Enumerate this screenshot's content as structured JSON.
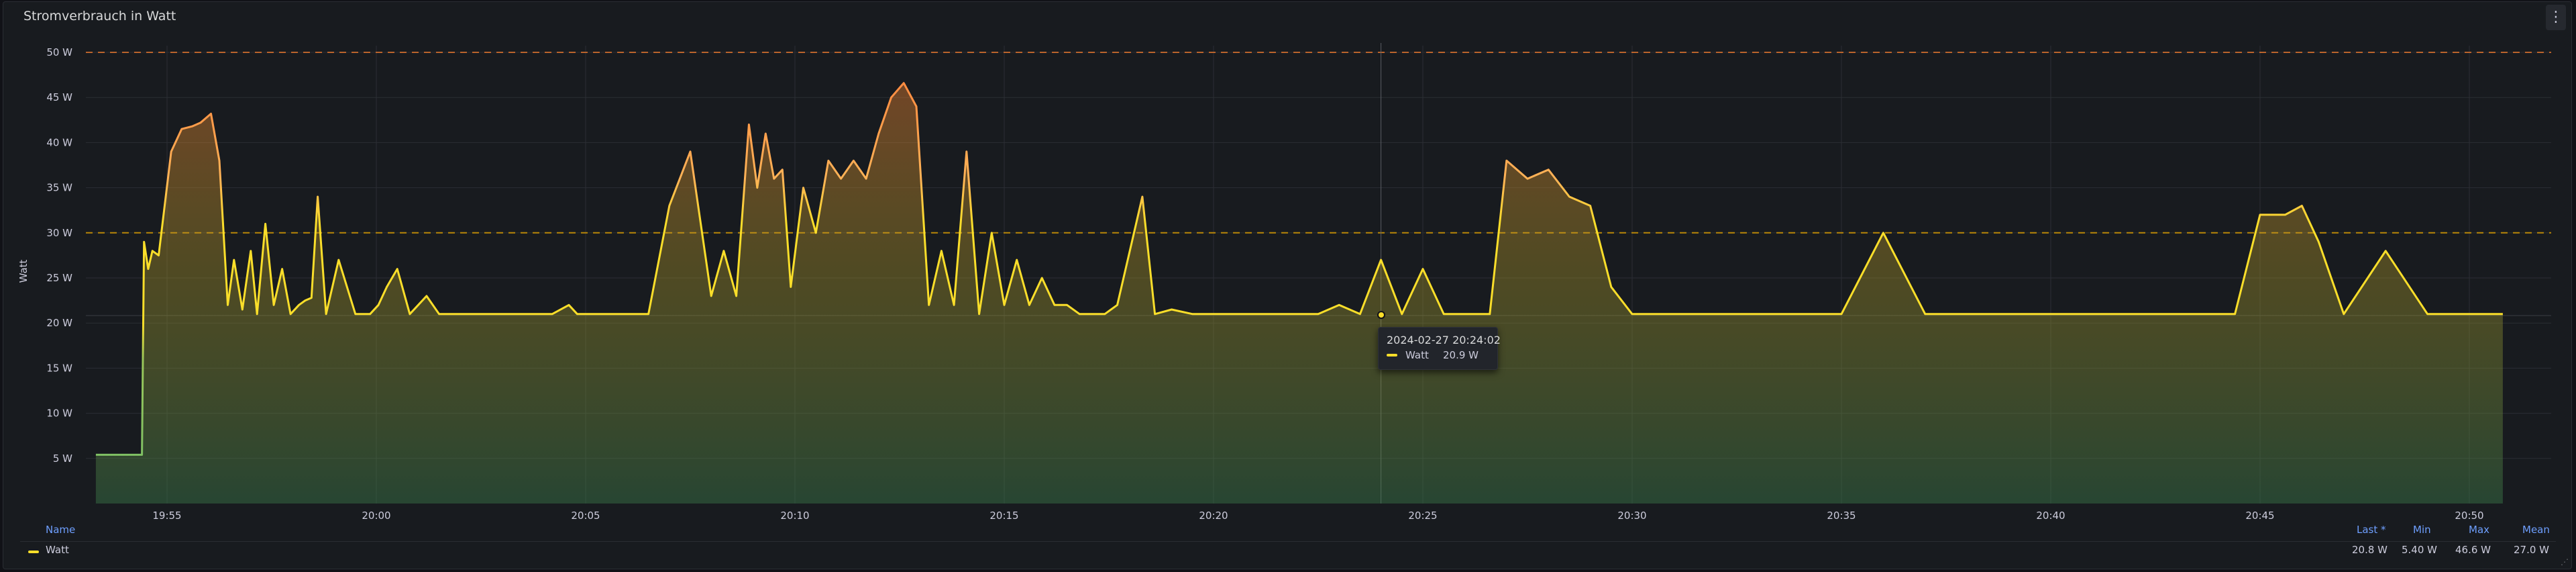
{
  "panel": {
    "title": "Stromverbrauch in Watt",
    "menu_icon": "⋮",
    "resize_icon": "⋰"
  },
  "colors": {
    "series": "#fade2a",
    "threshold_orange": "#ff9830",
    "threshold_red": "#e0752d",
    "grid": "#2b2e34",
    "axis_text": "#ccccdc"
  },
  "tooltip": {
    "time": "2024-02-27 20:24:02",
    "series": "Watt",
    "value": "20.9 W"
  },
  "legend": {
    "headers": {
      "name": "Name",
      "last": "Last *",
      "min": "Min",
      "max": "Max",
      "mean": "Mean"
    },
    "rows": [
      {
        "name": "Watt",
        "color": "#fade2a",
        "last": "20.8 W",
        "min": "5.40 W",
        "max": "46.6 W",
        "mean": "27.0 W"
      }
    ]
  },
  "chart_data": {
    "type": "area",
    "ylabel": "Watt",
    "ylim": [
      0,
      50
    ],
    "yticks": [
      "5 W",
      "10 W",
      "15 W",
      "20 W",
      "25 W",
      "30 W",
      "35 W",
      "40 W",
      "45 W",
      "50 W"
    ],
    "xticks": [
      "19:55",
      "20:00",
      "20:05",
      "20:10",
      "20:15",
      "20:20",
      "20:25",
      "20:30",
      "20:35",
      "20:40",
      "20:45",
      "20:50"
    ],
    "xlim_minutes_from_19_55": [
      -1.7,
      55.8
    ],
    "thresholds": [
      {
        "value": 30,
        "color": "#e0a000"
      },
      {
        "value": 50,
        "color": "#e0752d"
      }
    ],
    "hover_minute": 29.0,
    "series": [
      {
        "name": "Watt",
        "x_minutes_from_19_55": [
          -1.7,
          -0.6,
          -0.55,
          -0.45,
          -0.35,
          -0.2,
          0.1,
          0.35,
          0.6,
          0.8,
          1.05,
          1.25,
          1.45,
          1.6,
          1.8,
          2.0,
          2.15,
          2.35,
          2.55,
          2.75,
          2.95,
          3.15,
          3.3,
          3.45,
          3.6,
          3.8,
          4.1,
          4.5,
          4.85,
          5.05,
          5.25,
          5.5,
          5.8,
          6.2,
          6.5,
          6.8,
          7.2,
          7.6,
          8.0,
          8.4,
          8.8,
          9.2,
          9.6,
          9.8,
          10.0,
          10.5,
          11.0,
          11.5,
          12.0,
          12.5,
          13.0,
          13.3,
          13.6,
          13.9,
          14.1,
          14.3,
          14.5,
          14.7,
          14.9,
          15.2,
          15.5,
          15.8,
          16.1,
          16.4,
          16.7,
          17.0,
          17.3,
          17.6,
          17.9,
          18.2,
          18.5,
          18.8,
          19.1,
          19.4,
          19.7,
          20.0,
          20.3,
          20.6,
          20.9,
          21.2,
          21.5,
          21.8,
          22.1,
          22.4,
          22.7,
          23.0,
          23.3,
          23.6,
          24.0,
          24.5,
          25.0,
          25.5,
          26.0,
          26.5,
          27.0,
          27.5,
          28.0,
          28.5,
          29.0,
          29.5,
          30.0,
          30.5,
          31.0,
          31.2,
          31.4,
          31.6,
          32.0,
          32.5,
          33.0,
          33.5,
          34.0,
          34.5,
          35.0,
          35.4,
          35.6,
          36.0,
          37.0,
          38.0,
          39.0,
          39.3,
          39.6,
          40.0,
          41.0,
          42.0,
          43.0,
          44.0,
          45.0,
          46.0,
          47.0,
          48.0,
          49.0,
          49.4,
          50.0,
          50.6,
          51.0,
          51.4,
          52.0,
          53.0,
          54.0,
          55.0,
          55.8
        ],
        "values": [
          5.4,
          5.4,
          29,
          26,
          28,
          27.5,
          39,
          41.5,
          41.8,
          42.2,
          43.2,
          38,
          22,
          27,
          21.5,
          28,
          21,
          31,
          22,
          26,
          21,
          22,
          22.5,
          22.8,
          34,
          21,
          27,
          21,
          21,
          22,
          24,
          26,
          21,
          23,
          21,
          21,
          21,
          21,
          21,
          21,
          21,
          21,
          22,
          21,
          21,
          21,
          21,
          21,
          33,
          39,
          23,
          28,
          23,
          42,
          35,
          41,
          36,
          37,
          24,
          35,
          30,
          38,
          36,
          38,
          36,
          41,
          45,
          46.6,
          44,
          22,
          28,
          22,
          39,
          21,
          30,
          22,
          27,
          22,
          25,
          22,
          22,
          21,
          21,
          21,
          22,
          28,
          34,
          21,
          21.5,
          21,
          21,
          21,
          21,
          21,
          21,
          21,
          22,
          21,
          27,
          21,
          26,
          21,
          21,
          21,
          21,
          21,
          38,
          36,
          37,
          34,
          33,
          24,
          21,
          21,
          21,
          21,
          21,
          21,
          21,
          21,
          21,
          21,
          30,
          21,
          21,
          21,
          21,
          21,
          21,
          21,
          21,
          21,
          32,
          32,
          33,
          29,
          21,
          28,
          21,
          21,
          21,
          21,
          21,
          21,
          21,
          21,
          24,
          21,
          26,
          21,
          21,
          21,
          20.8
        ]
      }
    ]
  }
}
